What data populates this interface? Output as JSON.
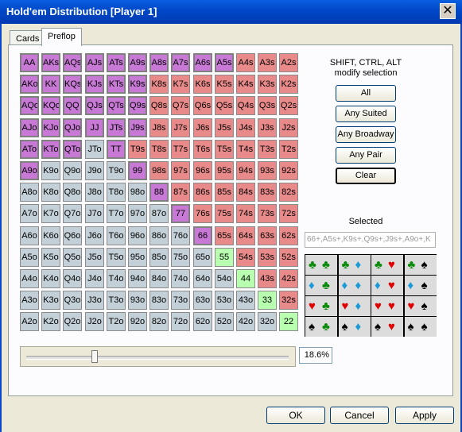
{
  "window": {
    "title": "Hold'em Distribution [Player 1]",
    "close_glyph": "✕"
  },
  "tabs": [
    {
      "label": "Cards",
      "active": false
    },
    {
      "label": "Preflop",
      "active": true
    }
  ],
  "hint": {
    "line1": "SHIFT, CTRL, ALT",
    "line2": "modify selection"
  },
  "quick_buttons": [
    {
      "label": "All",
      "focused": false
    },
    {
      "label": "Any Suited",
      "focused": false
    },
    {
      "label": "Any Broadway",
      "focused": false
    },
    {
      "label": "Any Pair",
      "focused": false
    },
    {
      "label": "Clear",
      "focused": true
    }
  ],
  "colors": {
    "pair": "#b8ffb0",
    "suited": "#e88a8a",
    "offsuit": "#c4d0d8",
    "selected": "#c879d6",
    "pair_selected": "#c879d6"
  },
  "hand_grid": {
    "ranks": [
      "A",
      "K",
      "Q",
      "J",
      "T",
      "9",
      "8",
      "7",
      "6",
      "5",
      "4",
      "3",
      "2"
    ],
    "selected_hands": [
      "AA",
      "AKs",
      "AQs",
      "AJs",
      "ATs",
      "A9s",
      "A8s",
      "A7s",
      "A6s",
      "A5s",
      "AKo",
      "KK",
      "KQs",
      "KJs",
      "KTs",
      "K9s",
      "AQo",
      "KQo",
      "QQ",
      "QJs",
      "QTs",
      "Q9s",
      "AJo",
      "KJo",
      "QJo",
      "JJ",
      "JTs",
      "J9s",
      "ATo",
      "KTo",
      "QTo",
      "TT",
      "A9o",
      "99",
      "88",
      "77",
      "66"
    ]
  },
  "selected_label": "Selected",
  "selected_text": "66+,A5s+,K9s+,Q9s+,J9s+,A9o+,K",
  "suit_combos": [
    [
      "♣♣",
      "♣♦",
      "♣♥",
      "♣♠"
    ],
    [
      "♦♣",
      "♦♦",
      "♦♥",
      "♦♠"
    ],
    [
      "♥♣",
      "♥♦",
      "♥♥",
      "♥♠"
    ],
    [
      "♠♣",
      "♠♦",
      "♠♥",
      "♠♠"
    ]
  ],
  "slider": {
    "percent_text": "18.6%",
    "value": 0.186
  },
  "footer": {
    "ok": "OK",
    "cancel": "Cancel",
    "apply": "Apply"
  }
}
